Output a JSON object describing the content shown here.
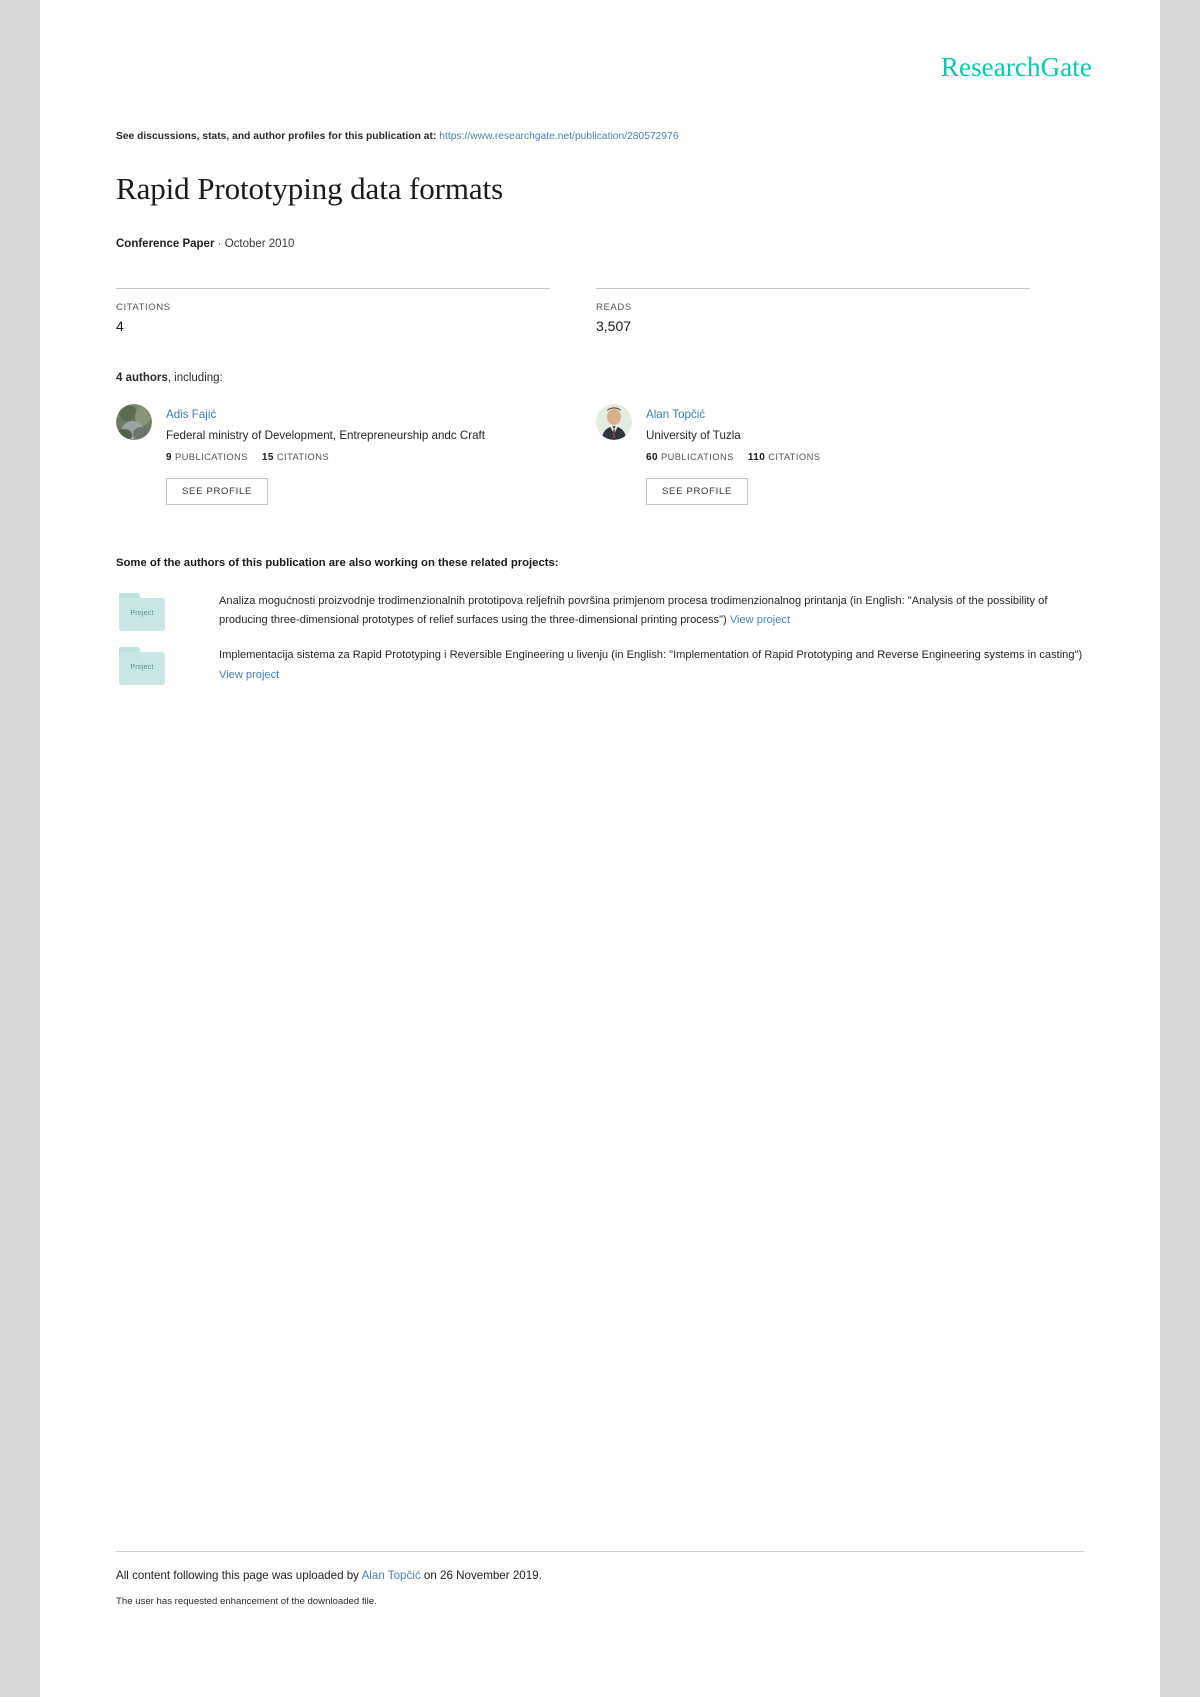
{
  "brand": {
    "logo_text": "ResearchGate",
    "logo_color": "#00ccb1",
    "link_color": "#4a7ebb"
  },
  "header": {
    "discussion_prefix": "See discussions, stats, and author profiles for this publication at:",
    "publication_url": "https://www.researchgate.net/publication/280572976"
  },
  "publication": {
    "title": "Rapid Prototyping data formats",
    "type": "Conference Paper",
    "separator": "·",
    "date": "October 2010"
  },
  "stats": [
    {
      "label": "CITATIONS",
      "value": "4"
    },
    {
      "label": "READS",
      "value": "3,507"
    }
  ],
  "authors_section": {
    "count_text": "4 authors",
    "including_text": ", including:",
    "authors": [
      {
        "name": "Adis Fajić",
        "affiliation": "Federal ministry of Development, Entrepreneurship andc Craft",
        "publications_count": "9",
        "publications_label": "PUBLICATIONS",
        "citations_count": "15",
        "citations_label": "CITATIONS",
        "profile_button": "SEE PROFILE"
      },
      {
        "name": "Alan Topčić",
        "affiliation": "University of Tuzla",
        "publications_count": "60",
        "publications_label": "PUBLICATIONS",
        "citations_count": "110",
        "citations_label": "CITATIONS",
        "profile_button": "SEE PROFILE"
      }
    ]
  },
  "projects_section": {
    "heading": "Some of the authors of this publication are also working on these related projects:",
    "icon_label": "Project",
    "link_label": "View project",
    "projects": [
      {
        "description": "Analiza mogućnosti proizvodnje trodimenzionalnih prototipova reljefnih površina primjenom procesa trodimenzionalnog printanja (in English: \"Analysis of the possibility of producing three-dimensional prototypes of relief surfaces using the three-dimensional printing process\")",
        "link": "View project"
      },
      {
        "description": "Implementacija sistema za Rapid Prototyping i Reversible Engineering u livenju (in English: \"Implementation of Rapid Prototyping and Reverse Engineering systems in casting\")",
        "link": "View project"
      }
    ]
  },
  "footer": {
    "upload_prefix": "All content following this page was uploaded by",
    "uploader": "Alan Topčić",
    "upload_suffix": "on 26 November 2019.",
    "enhancement_note": "The user has requested enhancement of the downloaded file."
  }
}
